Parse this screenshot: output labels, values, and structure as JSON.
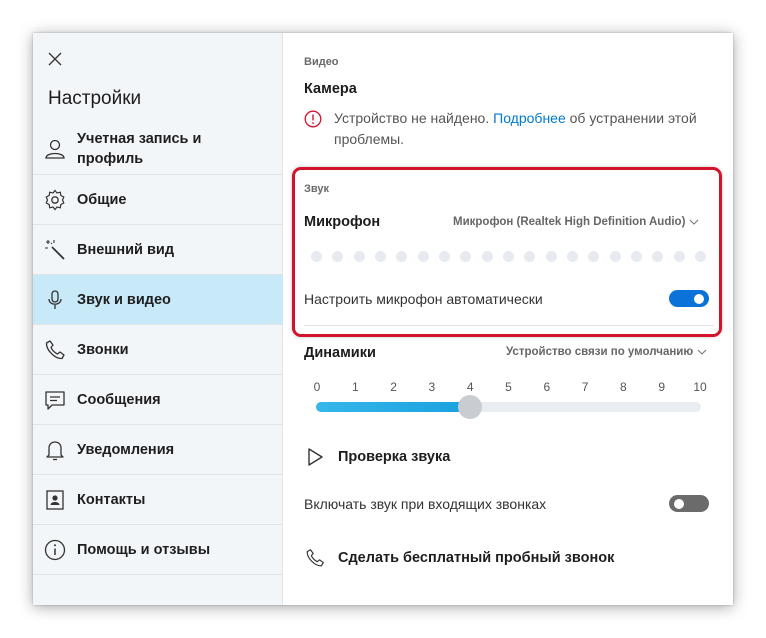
{
  "sidebar": {
    "title": "Настройки",
    "items": [
      {
        "label": "Учетная запись и профиль",
        "icon": "person-icon"
      },
      {
        "label": "Общие",
        "icon": "gear-icon"
      },
      {
        "label": "Внешний вид",
        "icon": "magic-wand-icon"
      },
      {
        "label": "Звук и видео",
        "icon": "microphone-icon",
        "active": true
      },
      {
        "label": "Звонки",
        "icon": "phone-icon"
      },
      {
        "label": "Сообщения",
        "icon": "message-icon"
      },
      {
        "label": "Уведомления",
        "icon": "bell-icon"
      },
      {
        "label": "Контакты",
        "icon": "contacts-icon"
      },
      {
        "label": "Помощь и отзывы",
        "icon": "info-icon"
      }
    ]
  },
  "video": {
    "section_label": "Видео",
    "camera_title": "Камера",
    "warning_text": "Устройство не найдено.",
    "warning_link": "Подробнее",
    "warning_rest": "об устранении этой проблемы."
  },
  "sound": {
    "section_label": "Звук",
    "microphone_title": "Микрофон",
    "microphone_device": "Микрофон (Realtek High Definition Audio)",
    "auto_adjust_label": "Настроить микрофон автоматически",
    "auto_adjust_on": true,
    "level_dot_count": 19
  },
  "speakers": {
    "title": "Динамики",
    "device": "Устройство связи по умолчанию",
    "scale": [
      "0",
      "1",
      "2",
      "3",
      "4",
      "5",
      "6",
      "7",
      "8",
      "9",
      "10"
    ],
    "volume": 4,
    "volume_max": 10
  },
  "sound_test_label": "Проверка звука",
  "incoming_ring": {
    "label": "Включать звук при входящих звонках",
    "on": false
  },
  "test_call_label": "Сделать бесплатный пробный звонок",
  "colors": {
    "accent": "#0a72d8",
    "active_nav": "#c7e9f8",
    "highlight_border": "#d3132a",
    "warning": "#d3132a"
  }
}
